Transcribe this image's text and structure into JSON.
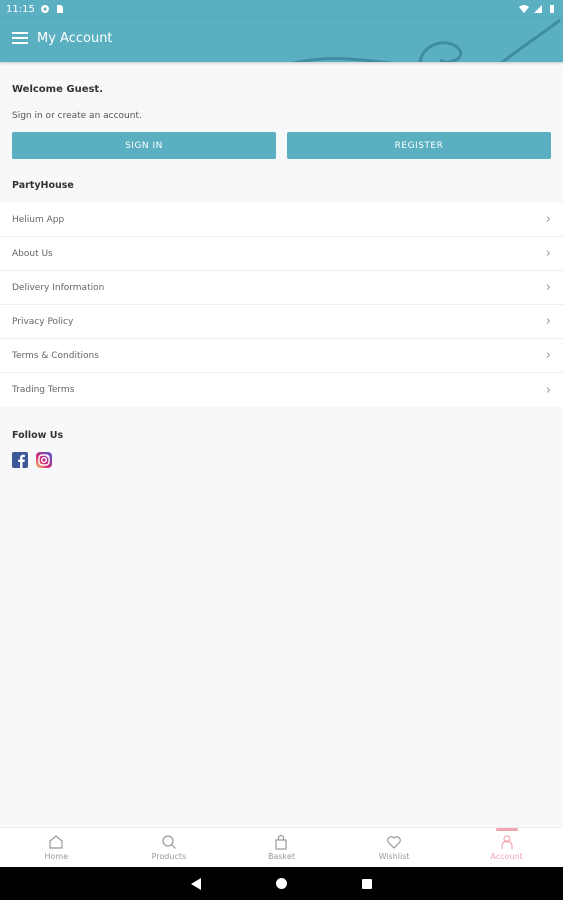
{
  "status_bar": {
    "time": "11:15",
    "icons": [
      "settings-icon",
      "sim-icon",
      "wifi-icon",
      "signal-icon",
      "battery-icon"
    ]
  },
  "app_bar": {
    "title": "My Account",
    "background": "#5aafc1"
  },
  "welcome": {
    "heading": "Welcome Guest.",
    "subtext": "Sign in or create an account.",
    "sign_in_label": "SIGN IN",
    "register_label": "REGISTER"
  },
  "partyhouse": {
    "title": "PartyHouse",
    "items": [
      {
        "label": "Helium App"
      },
      {
        "label": "About Us"
      },
      {
        "label": "Delivery Information"
      },
      {
        "label": "Privacy Policy"
      },
      {
        "label": "Terms & Conditions"
      },
      {
        "label": "Trading Terms"
      }
    ]
  },
  "follow": {
    "title": "Follow Us",
    "icons": [
      "facebook-icon",
      "instagram-icon"
    ]
  },
  "bottom_nav": {
    "items": [
      {
        "label": "Home",
        "icon": "home-icon",
        "active": false
      },
      {
        "label": "Products",
        "icon": "search-icon",
        "active": false
      },
      {
        "label": "Basket",
        "icon": "basket-icon",
        "active": false
      },
      {
        "label": "Wishlist",
        "icon": "heart-icon",
        "active": false
      },
      {
        "label": "Account",
        "icon": "user-icon",
        "active": true
      }
    ],
    "active_color": "#f1a4b1"
  }
}
